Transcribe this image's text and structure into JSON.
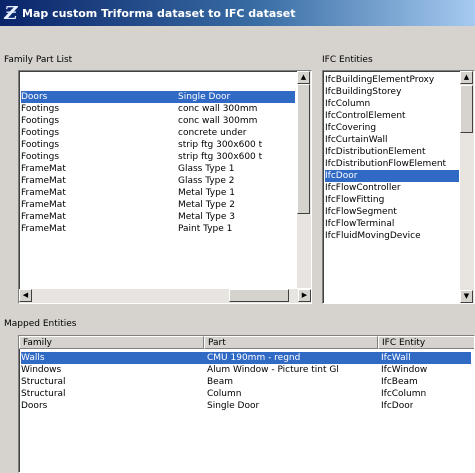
{
  "window": {
    "title": "Map custom Triforma dataset to IFC dataset",
    "icon": "app-logo-icon"
  },
  "family_part_list": {
    "label": "Family Part List",
    "rows": [
      {
        "family": "Doors",
        "part": "Single Door",
        "selected": true
      },
      {
        "family": "Footings",
        "part": "conc wall 300mm",
        "selected": false
      },
      {
        "family": "Footings",
        "part": "conc wall 300mm",
        "selected": false
      },
      {
        "family": "Footings",
        "part": "concrete under",
        "selected": false
      },
      {
        "family": "Footings",
        "part": "strip ftg 300x600 t",
        "selected": false
      },
      {
        "family": "Footings",
        "part": "strip ftg 300x600 t",
        "selected": false
      },
      {
        "family": "FrameMat",
        "part": "Glass Type 1",
        "selected": false
      },
      {
        "family": "FrameMat",
        "part": "Glass Type 2",
        "selected": false
      },
      {
        "family": "FrameMat",
        "part": "Metal Type 1",
        "selected": false
      },
      {
        "family": "FrameMat",
        "part": "Metal Type 2",
        "selected": false
      },
      {
        "family": "FrameMat",
        "part": "Metal Type 3",
        "selected": false
      },
      {
        "family": "FrameMat",
        "part": "Paint Type 1",
        "selected": false
      }
    ]
  },
  "ifc_entities": {
    "label": "IFC Entities",
    "items": [
      {
        "label": "IfcBuildingElementProxy",
        "selected": false
      },
      {
        "label": "IfcBuildingStorey",
        "selected": false
      },
      {
        "label": "IfcColumn",
        "selected": false
      },
      {
        "label": "IfcControlElement",
        "selected": false
      },
      {
        "label": "IfcCovering",
        "selected": false
      },
      {
        "label": "IfcCurtainWall",
        "selected": false
      },
      {
        "label": "IfcDistributionElement",
        "selected": false
      },
      {
        "label": "IfcDistributionFlowElement",
        "selected": false
      },
      {
        "label": "IfcDoor",
        "selected": true
      },
      {
        "label": "IfcFlowController",
        "selected": false
      },
      {
        "label": "IfcFlowFitting",
        "selected": false
      },
      {
        "label": "IfcFlowSegment",
        "selected": false
      },
      {
        "label": "IfcFlowTerminal",
        "selected": false
      },
      {
        "label": "IfcFluidMovingDevice",
        "selected": false
      }
    ]
  },
  "mapped_entities": {
    "label": "Mapped Entities",
    "columns": [
      "Family",
      "Part",
      "IFC Entity"
    ],
    "rows": [
      {
        "family": "Walls",
        "part": "CMU 190mm - regnd",
        "entity": "IfcWall",
        "selected": true
      },
      {
        "family": "Windows",
        "part": "Alum Window - Picture  tint Gl",
        "entity": "IfcWindow",
        "selected": false
      },
      {
        "family": "Structural",
        "part": "Beam",
        "entity": "IfcBeam",
        "selected": false
      },
      {
        "family": "Structural",
        "part": "Column",
        "entity": "IfcColumn",
        "selected": false
      },
      {
        "family": "Doors",
        "part": "Single Door",
        "entity": "IfcDoor",
        "selected": false
      }
    ]
  },
  "colors": {
    "selection": "#316ac5",
    "title_gradient_start": "#0a246a",
    "title_gradient_end": "#a6caf0",
    "window_face": "#d6d3ce"
  }
}
